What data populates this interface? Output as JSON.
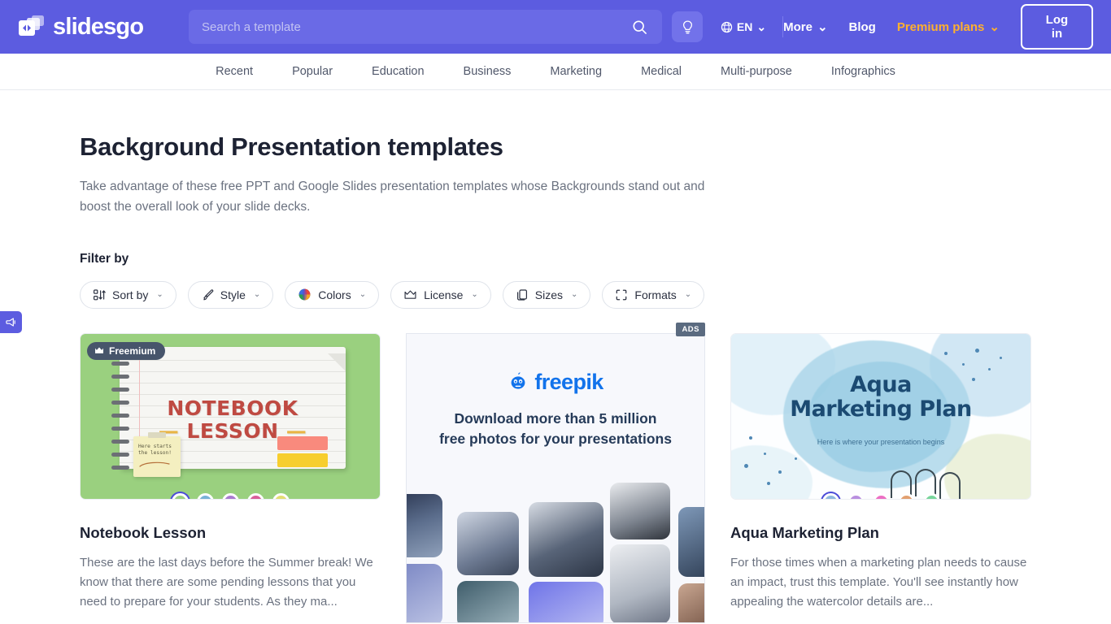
{
  "brand": {
    "name": "slidesgo",
    "logo_icon": "slidesgo-logo-icon",
    "accent": "#5c5ce0",
    "premium_color": "#ffb02e"
  },
  "header": {
    "search": {
      "placeholder": "Search a template",
      "value": "",
      "icon": "search-icon"
    },
    "bulb_icon": "lightbulb-icon",
    "language": {
      "label": "EN",
      "globe_icon": "globe-icon",
      "caret": "⌄"
    },
    "links": [
      {
        "label": "More",
        "caret": "⌄",
        "premium": false
      },
      {
        "label": "Blog",
        "caret": "",
        "premium": false
      },
      {
        "label": "Premium plans",
        "caret": "⌄",
        "premium": true
      }
    ],
    "login_label": "Log in"
  },
  "categories": [
    "Recent",
    "Popular",
    "Education",
    "Business",
    "Marketing",
    "Medical",
    "Multi-purpose",
    "Infographics"
  ],
  "page": {
    "title": "Background Presentation templates",
    "description": "Take advantage of these free PPT and Google Slides presentation templates whose Backgrounds stand out and boost the overall look of your slide decks."
  },
  "filters": {
    "label": "Filter by",
    "buttons": [
      {
        "label": "Sort by",
        "icon": "sort-icon",
        "caret": "⌄"
      },
      {
        "label": "Style",
        "icon": "brush-icon",
        "caret": "⌄"
      },
      {
        "label": "Colors",
        "icon": "palette-icon",
        "caret": "⌄"
      },
      {
        "label": "License",
        "icon": "crown-icon",
        "caret": "⌄"
      },
      {
        "label": "Sizes",
        "icon": "page-icon",
        "caret": "⌄"
      },
      {
        "label": "Formats",
        "icon": "frame-icon",
        "caret": "⌄"
      }
    ]
  },
  "cards": [
    {
      "id": "notebook-lesson",
      "title": "Notebook Lesson",
      "description": "These are the last days before the Summer break! We know that there are some pending lessons that you need to prepare for your students. As they ma...",
      "badge": {
        "label": "Freemium",
        "icon": "crown-icon"
      },
      "thumb": {
        "type": "notebook",
        "bg": "#9ad07f",
        "title_line1": "NOTEBOOK",
        "title_line2": "LESSON",
        "sticky_note": "Here starts\nthe lesson!"
      },
      "swatches": [
        {
          "color": "#9ad07f",
          "active": true
        },
        {
          "color": "#79b2d6",
          "active": false
        },
        {
          "color": "#a97ad0",
          "active": false
        },
        {
          "color": "#d95f9a",
          "active": false
        },
        {
          "color": "#e3dd72",
          "active": false
        }
      ]
    },
    {
      "id": "aqua-marketing-plan",
      "title": "Aqua Marketing Plan",
      "description": "For those times when a marketing plan needs to cause an impact, trust this template. You'll see instantly how appealing the watercolor details are...",
      "badge": null,
      "thumb": {
        "type": "aqua",
        "bg": "#fdfeff",
        "title_line1": "Aqua",
        "title_line2": "Marketing Plan",
        "subtitle": "Here is where your presentation begins"
      },
      "swatches": [
        {
          "color": "#8fb9de",
          "active": true
        },
        {
          "color": "#b98fe0",
          "active": false
        },
        {
          "color": "#ec6fc4",
          "active": false
        },
        {
          "color": "#e2a070",
          "active": false
        },
        {
          "color": "#77d59b",
          "active": false
        }
      ]
    }
  ],
  "ad": {
    "label": "ADS",
    "logo_text": "freepik",
    "logo_icon": "freepik-logo-icon",
    "headline_line1": "Download more than 5 million",
    "headline_line2": "free photos for your presentations"
  },
  "side_tab": {
    "icon": "megaphone-icon"
  }
}
